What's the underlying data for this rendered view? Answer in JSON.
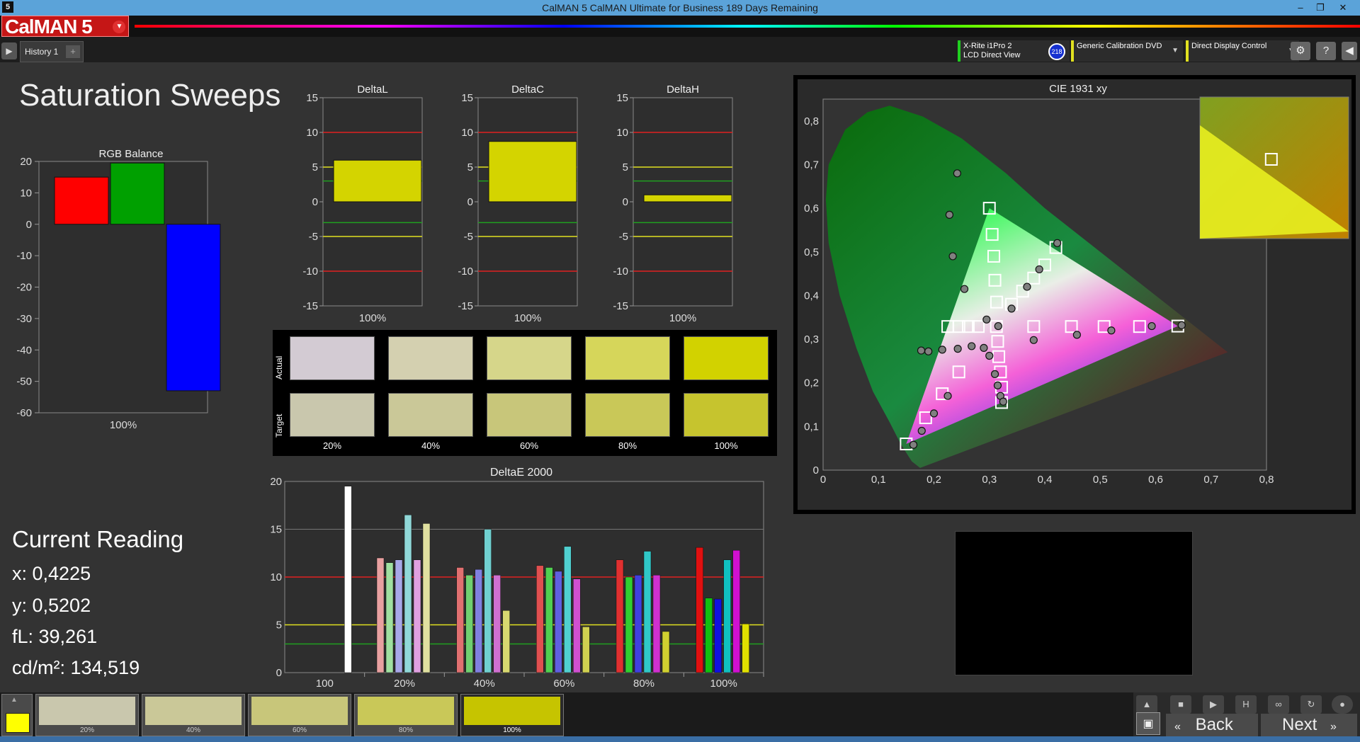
{
  "window": {
    "title": "CalMAN 5 CalMAN Ultimate for Business 189 Days Remaining",
    "app_icon": "5"
  },
  "logo": {
    "text": "CalMAN 5"
  },
  "tabs": [
    {
      "label": "History 1"
    }
  ],
  "devices": [
    {
      "line1": "X-Rite i1Pro 2",
      "line2": "LCD Direct View",
      "badge": "218"
    },
    {
      "line1": "Generic Calibration DVD",
      "line2": ""
    },
    {
      "line1": "Direct Display Control",
      "line2": ""
    }
  ],
  "toolbar_icons": [
    "gear-icon",
    "help-icon",
    "collapse-icon"
  ],
  "page": {
    "title": "Saturation Sweeps"
  },
  "rgb_balance": {
    "chart_data": {
      "type": "bar",
      "title": "RGB Balance",
      "categories": [
        "Red",
        "Green",
        "Blue"
      ],
      "values": [
        15,
        19.5,
        -53
      ],
      "colors": [
        "#ff0000",
        "#00a000",
        "#0000ff"
      ],
      "ylim": [
        -60,
        20
      ],
      "yticks": [
        "20",
        "10",
        "0",
        "-10",
        "-20",
        "-30",
        "-40",
        "-50",
        "-60"
      ],
      "xlabel": "100%"
    }
  },
  "delta_charts": [
    {
      "chart_data": {
        "type": "bar",
        "title": "DeltaL",
        "categories": [
          "100%"
        ],
        "values": [
          6
        ],
        "ylim": [
          -15,
          15
        ],
        "yticks": [
          "15",
          "10",
          "5",
          "0",
          "-5",
          "-10",
          "-15"
        ],
        "xlabel": "100%"
      }
    },
    {
      "chart_data": {
        "type": "bar",
        "title": "DeltaC",
        "categories": [
          "100%"
        ],
        "values": [
          8.7
        ],
        "ylim": [
          -15,
          15
        ],
        "yticks": [
          "15",
          "10",
          "5",
          "0",
          "-5",
          "-10",
          "-15"
        ],
        "xlabel": "100%"
      }
    },
    {
      "chart_data": {
        "type": "bar",
        "title": "DeltaH",
        "categories": [
          "100%"
        ],
        "values": [
          1
        ],
        "ylim": [
          -15,
          15
        ],
        "yticks": [
          "15",
          "10",
          "5",
          "0",
          "-5",
          "-10",
          "-15"
        ],
        "xlabel": "100%"
      }
    }
  ],
  "swatches": {
    "actual_label": "Actual",
    "target_label": "Target",
    "items": [
      {
        "label": "20%",
        "actual": "#d3cbd3",
        "target": "#c9c7ad"
      },
      {
        "label": "40%",
        "actual": "#d4d0b0",
        "target": "#cac898"
      },
      {
        "label": "60%",
        "actual": "#d6d68a",
        "target": "#c8c67a"
      },
      {
        "label": "80%",
        "actual": "#d6d65a",
        "target": "#c9c858"
      },
      {
        "label": "100%",
        "actual": "#d2d200",
        "target": "#c6c42e"
      }
    ]
  },
  "deltae": {
    "chart_data": {
      "type": "bar",
      "title": "DeltaE 2000",
      "categories": [
        "100",
        "20%",
        "40%",
        "60%",
        "80%",
        "100%"
      ],
      "ylim": [
        0,
        20
      ],
      "yticks": [
        "20",
        "15",
        "10",
        "5",
        "0"
      ],
      "groups": [
        {
          "values": [
            19.5
          ],
          "colors": [
            "#ffffff"
          ]
        },
        {
          "values": [
            12,
            11.5,
            11.8,
            16.5,
            11.8,
            15.6
          ],
          "colors": [
            "#e8a0a0",
            "#a0e0a0",
            "#a8a8e8",
            "#90d8d8",
            "#e0a0e0",
            "#e0e0a0"
          ]
        },
        {
          "values": [
            11,
            10.2,
            10.8,
            15,
            10.2,
            6.5
          ],
          "colors": [
            "#e07070",
            "#70d070",
            "#8080e0",
            "#70d0d0",
            "#d070d0",
            "#d8d870"
          ]
        },
        {
          "values": [
            11.2,
            11,
            10.6,
            13.2,
            9.8,
            4.8
          ],
          "colors": [
            "#e05050",
            "#50d050",
            "#6060e0",
            "#50d0d0",
            "#d050d0",
            "#d0d050"
          ]
        },
        {
          "values": [
            11.8,
            10,
            10.2,
            12.7,
            10.2,
            4.3
          ],
          "colors": [
            "#e03030",
            "#30d030",
            "#4040e0",
            "#30c8c8",
            "#d030d0",
            "#d0d030"
          ]
        },
        {
          "values": [
            13.1,
            7.8,
            7.7,
            11.8,
            12.8,
            5.1
          ],
          "colors": [
            "#e01010",
            "#10c010",
            "#1010e0",
            "#10c0c0",
            "#d010d0",
            "#e0e000"
          ]
        }
      ]
    }
  },
  "cie": {
    "chart_data": {
      "type": "scatter",
      "title": "CIE 1931 xy",
      "xlim": [
        0,
        0.8
      ],
      "ylim": [
        0,
        0.85
      ],
      "xticks": [
        "0",
        "0,1",
        "0,2",
        "0,3",
        "0,4",
        "0,5",
        "0,6",
        "0,7",
        "0,8"
      ],
      "yticks": [
        "0,8",
        "0,7",
        "0,6",
        "0,5",
        "0,4",
        "0,3",
        "0,2",
        "0,1",
        "0"
      ],
      "gamut": [
        [
          0.64,
          0.33
        ],
        [
          0.3,
          0.6
        ],
        [
          0.15,
          0.06
        ]
      ],
      "target_series": [
        [
          0.15,
          0.06
        ],
        [
          0.185,
          0.12
        ],
        [
          0.215,
          0.175
        ],
        [
          0.245,
          0.225
        ],
        [
          0.3,
          0.6
        ],
        [
          0.305,
          0.54
        ],
        [
          0.308,
          0.49
        ],
        [
          0.31,
          0.435
        ],
        [
          0.313,
          0.385
        ],
        [
          0.3127,
          0.329
        ],
        [
          0.225,
          0.329
        ],
        [
          0.245,
          0.329
        ],
        [
          0.262,
          0.329
        ],
        [
          0.28,
          0.329
        ],
        [
          0.38,
          0.329
        ],
        [
          0.448,
          0.329
        ],
        [
          0.507,
          0.329
        ],
        [
          0.571,
          0.329
        ],
        [
          0.64,
          0.33
        ],
        [
          0.315,
          0.295
        ],
        [
          0.317,
          0.26
        ],
        [
          0.32,
          0.225
        ],
        [
          0.322,
          0.19
        ],
        [
          0.322,
          0.155
        ],
        [
          0.34,
          0.38
        ],
        [
          0.36,
          0.41
        ],
        [
          0.38,
          0.44
        ],
        [
          0.4,
          0.47
        ],
        [
          0.42,
          0.51
        ]
      ],
      "measured_series": [
        [
          0.163,
          0.058
        ],
        [
          0.178,
          0.09
        ],
        [
          0.2,
          0.13
        ],
        [
          0.225,
          0.17
        ],
        [
          0.242,
          0.68
        ],
        [
          0.228,
          0.585
        ],
        [
          0.234,
          0.49
        ],
        [
          0.255,
          0.415
        ],
        [
          0.295,
          0.345
        ],
        [
          0.316,
          0.33
        ],
        [
          0.177,
          0.274
        ],
        [
          0.19,
          0.272
        ],
        [
          0.215,
          0.276
        ],
        [
          0.243,
          0.278
        ],
        [
          0.268,
          0.284
        ],
        [
          0.29,
          0.28
        ],
        [
          0.38,
          0.298
        ],
        [
          0.458,
          0.31
        ],
        [
          0.52,
          0.32
        ],
        [
          0.593,
          0.33
        ],
        [
          0.647,
          0.332
        ],
        [
          0.3,
          0.262
        ],
        [
          0.31,
          0.22
        ],
        [
          0.315,
          0.194
        ],
        [
          0.32,
          0.17
        ],
        [
          0.325,
          0.157
        ],
        [
          0.34,
          0.37
        ],
        [
          0.368,
          0.42
        ],
        [
          0.39,
          0.46
        ],
        [
          0.4225,
          0.5202
        ]
      ],
      "inset_points": {
        "measured": [
          0.7,
          0.8
        ],
        "target": [
          0.6,
          0.55
        ]
      }
    }
  },
  "current_reading": {
    "title": "Current Reading",
    "x": "x: 0,4225",
    "y": "y: 0,5202",
    "fl": "fL: 39,261",
    "cdm2": "cd/m²: 134,519"
  },
  "bottom": {
    "current_color": "#ffff00",
    "swatches": [
      {
        "label": "20%",
        "color": "#c9c7ad"
      },
      {
        "label": "40%",
        "color": "#cac898"
      },
      {
        "label": "60%",
        "color": "#c8c67a"
      },
      {
        "label": "80%",
        "color": "#c9c858"
      },
      {
        "label": "100%",
        "color": "#c6c400"
      }
    ],
    "back_label": "Back",
    "next_label": "Next"
  }
}
